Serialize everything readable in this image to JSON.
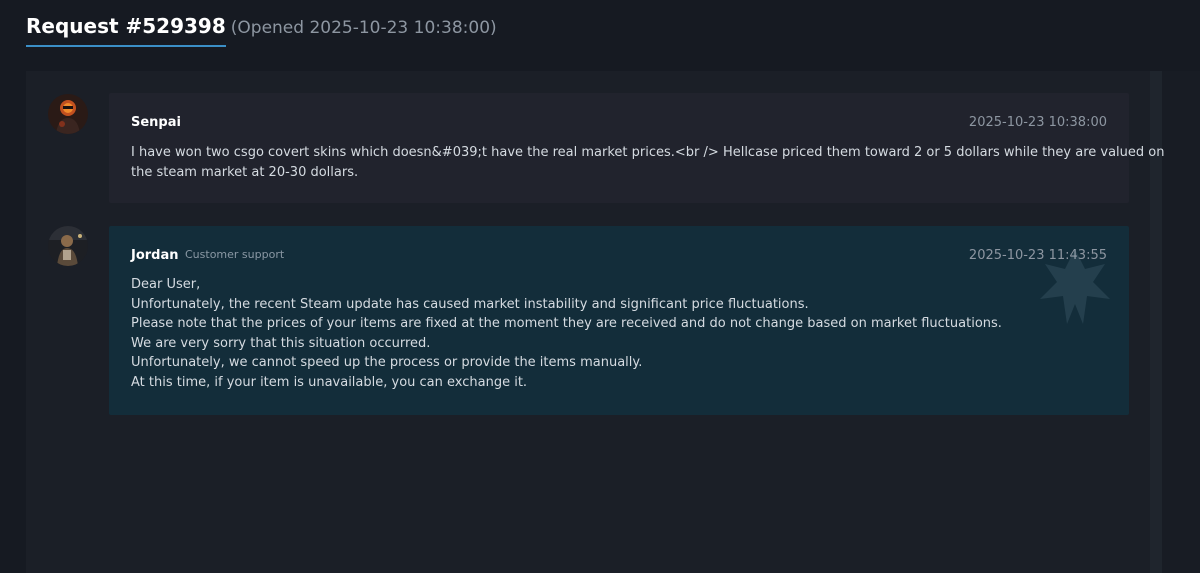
{
  "header": {
    "title": "Request #529398",
    "opened": "(Opened 2025-10-23 10:38:00)"
  },
  "messages": [
    {
      "author": "Senpai",
      "role": "",
      "time": "2025-10-23 10:38:00",
      "lines": [
        "I have won two csgo covert skins which doesn&#039;t have the real market prices.<br /> Hellcase priced them toward 2 or 5 dollars while they are valued on",
        "the steam market at 20-30 dollars."
      ]
    },
    {
      "author": "Jordan",
      "role": "Customer support",
      "time": "2025-10-23 11:43:55",
      "lines": [
        "Dear User,",
        "Unfortunately, the recent Steam update has caused market instability and significant price fluctuations.",
        "Please note that the prices of your items are fixed at the moment they are received and do not change based on market fluctuations.",
        "We are very sorry that this situation occurred.",
        "Unfortunately, we cannot speed up the process or provide the items manually.",
        "At this time, if your item is unavailable, you can exchange it."
      ]
    }
  ],
  "colors": {
    "background": "#161a22",
    "accent": "#3b8fc7",
    "user_message_bg": "#21232d",
    "support_message_bg": "#132d3a"
  },
  "icons": {
    "user_avatar": "avatar",
    "support_avatar": "avatar",
    "watermark": "hellcase-logo-icon"
  }
}
